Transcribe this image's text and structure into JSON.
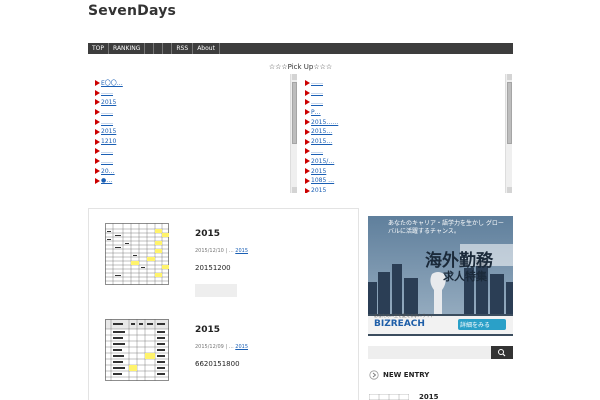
{
  "site": {
    "title": "SevenDays"
  },
  "nav": {
    "items": [
      "TOP",
      "RANKING",
      "",
      "",
      "",
      "RSS",
      "About"
    ]
  },
  "pickup": {
    "title": "☆☆☆Pick Up☆☆☆",
    "left": [
      "E〇〇…",
      "……",
      "2015",
      "……",
      "……",
      "2015",
      "1210",
      "……",
      "……",
      "20…",
      "●…"
    ],
    "right": [
      "……",
      "……",
      "……",
      "P…",
      "2015……",
      "2015…",
      "2015…",
      "……",
      "2015/…",
      "2015",
      "1085 …",
      "2015"
    ]
  },
  "entries": [
    {
      "title": "2015",
      "date": "2015/12/10",
      "category": "2015",
      "body": "20151200"
    },
    {
      "title": "2015",
      "date": "2015/12/09",
      "category": "2015",
      "body": "6620151800"
    }
  ],
  "ad": {
    "top_text": "あなたのキャリア・語学力を生かし グローバルに活躍するチャンス。",
    "heading": "海外勤務",
    "subheading": "求人特集",
    "brand": "BIZREACH",
    "brand_tag": "あなたの人生を変える求人サイト",
    "cta": "詳細をみる"
  },
  "sidebar": {
    "search_placeholder": "",
    "new_entry_title": "NEW ENTRY",
    "first_entry_title": "2015"
  },
  "colors": {
    "nav_bg": "#3d3d3d",
    "link": "#1a5fb4",
    "bullet": "#cc0000",
    "ad_cta": "#2aa0c8"
  }
}
